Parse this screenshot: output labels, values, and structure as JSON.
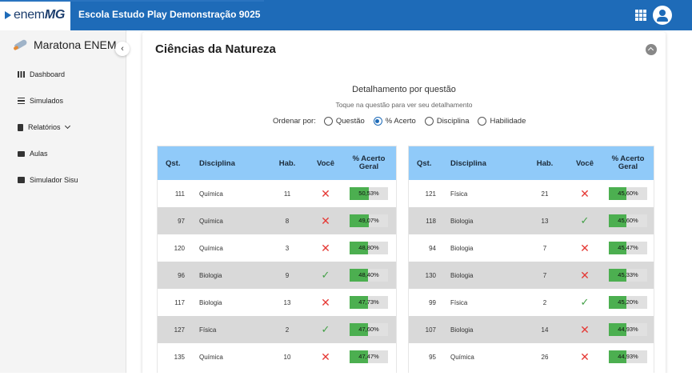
{
  "header": {
    "brand_prefix": "enem",
    "brand_suffix": "MG",
    "school_title": "Escola Estudo Play Demonstração 9025",
    "bar_color": "#1e6bb8"
  },
  "sidebar": {
    "title": "Maratona ENEM",
    "items": [
      {
        "label": "Dashboard",
        "icon": "dashboard-icon"
      },
      {
        "label": "Simulados",
        "icon": "list-icon"
      },
      {
        "label": "Relatórios",
        "icon": "document-icon",
        "has_submenu": true
      },
      {
        "label": "Aulas",
        "icon": "movie-icon"
      },
      {
        "label": "Simulador Sisu",
        "icon": "bar-chart-icon"
      }
    ]
  },
  "main": {
    "title": "Ciências da Natureza",
    "detail_title": "Detalhamento por questão",
    "detail_subtitle": "Toque na questão para ver seu detalhamento",
    "sort_label": "Ordenar por:",
    "sort_options": [
      {
        "label": "Questão",
        "selected": false
      },
      {
        "label": "% Acerto",
        "selected": true
      },
      {
        "label": "Disciplina",
        "selected": false
      },
      {
        "label": "Habilidade",
        "selected": false
      }
    ],
    "columns": {
      "qst": "Qst.",
      "disciplina": "Disciplina",
      "hab": "Hab.",
      "voce": "Você",
      "acerto": "% Acerto Geral"
    },
    "left_rows": [
      {
        "qst": "111",
        "disciplina": "Química",
        "hab": "11",
        "voce": "wrong",
        "acerto": "50,53%",
        "pct": 50.53
      },
      {
        "qst": "97",
        "disciplina": "Química",
        "hab": "8",
        "voce": "wrong",
        "acerto": "49,07%",
        "pct": 49.07
      },
      {
        "qst": "120",
        "disciplina": "Química",
        "hab": "3",
        "voce": "wrong",
        "acerto": "48,80%",
        "pct": 48.8
      },
      {
        "qst": "96",
        "disciplina": "Biologia",
        "hab": "9",
        "voce": "right",
        "acerto": "48,40%",
        "pct": 48.4
      },
      {
        "qst": "117",
        "disciplina": "Biologia",
        "hab": "13",
        "voce": "wrong",
        "acerto": "47,73%",
        "pct": 47.73
      },
      {
        "qst": "127",
        "disciplina": "Física",
        "hab": "2",
        "voce": "right",
        "acerto": "47,60%",
        "pct": 47.6
      },
      {
        "qst": "135",
        "disciplina": "Química",
        "hab": "10",
        "voce": "wrong",
        "acerto": "47,47%",
        "pct": 47.47
      }
    ],
    "right_rows": [
      {
        "qst": "121",
        "disciplina": "Física",
        "hab": "21",
        "voce": "wrong",
        "acerto": "45,60%",
        "pct": 45.6
      },
      {
        "qst": "118",
        "disciplina": "Biologia",
        "hab": "13",
        "voce": "right",
        "acerto": "45,60%",
        "pct": 45.6
      },
      {
        "qst": "94",
        "disciplina": "Biologia",
        "hab": "7",
        "voce": "wrong",
        "acerto": "45,47%",
        "pct": 45.47
      },
      {
        "qst": "130",
        "disciplina": "Biologia",
        "hab": "7",
        "voce": "wrong",
        "acerto": "45,33%",
        "pct": 45.33
      },
      {
        "qst": "99",
        "disciplina": "Física",
        "hab": "2",
        "voce": "right",
        "acerto": "45,20%",
        "pct": 45.2
      },
      {
        "qst": "107",
        "disciplina": "Biologia",
        "hab": "14",
        "voce": "wrong",
        "acerto": "44,93%",
        "pct": 44.93
      },
      {
        "qst": "95",
        "disciplina": "Química",
        "hab": "26",
        "voce": "wrong",
        "acerto": "44,93%",
        "pct": 44.93
      }
    ],
    "colors": {
      "header_bg": "#90caf9",
      "bar_fill": "#4caf50",
      "wrong": "#e53935",
      "right": "#43a047"
    }
  }
}
